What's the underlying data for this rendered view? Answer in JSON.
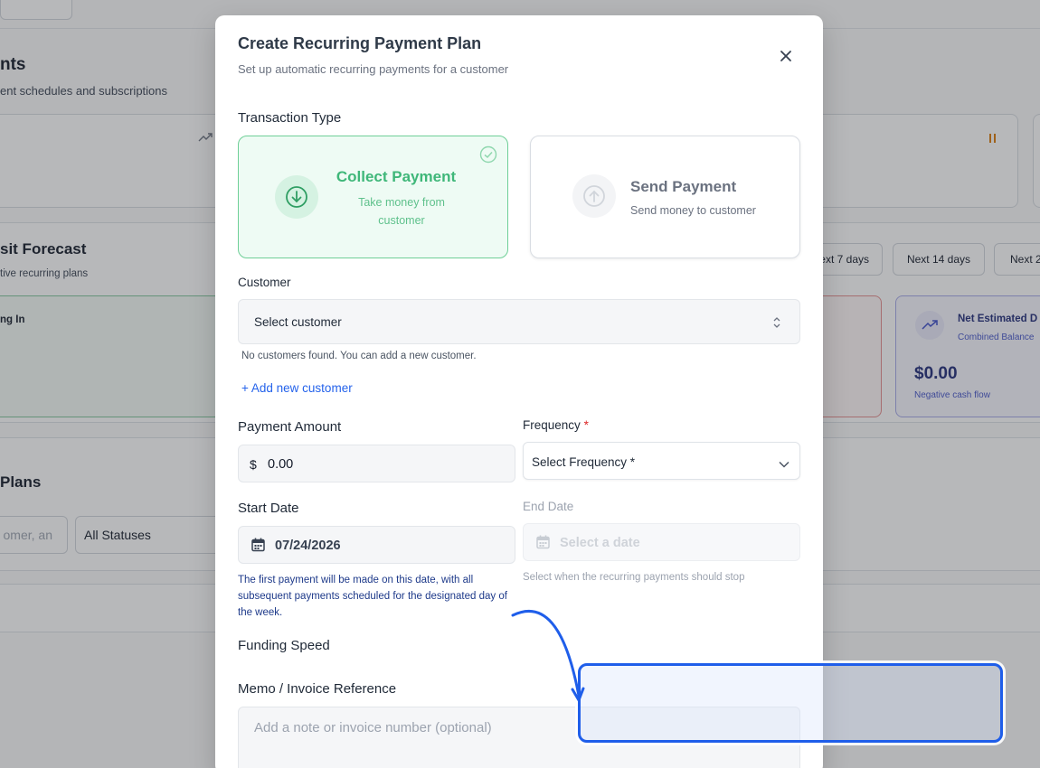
{
  "background": {
    "page_title_fragment": "nts",
    "page_subtitle_fragment": "ent schedules and subscriptions",
    "forecast_title_fragment": "sit Forecast",
    "forecast_subtitle_fragment": "tive recurring plans",
    "coming_in_fragment": "ng In",
    "range_buttons": [
      "ext 7 days",
      "Next 14 days",
      "Next 2"
    ],
    "net_card": {
      "title": "Net Estimated D",
      "subtitle": "Combined Balance",
      "value": "$0.00",
      "note": "Negative cash flow"
    },
    "plans_title_fragment": "Plans",
    "search_fragment": "omer, an",
    "status_filter": "All Statuses"
  },
  "modal": {
    "title": "Create Recurring Payment Plan",
    "subtitle": "Set up automatic recurring payments for a customer",
    "transaction_type": {
      "label": "Transaction Type",
      "collect": {
        "title": "Collect Payment",
        "desc": "Take money from customer",
        "selected": true
      },
      "send": {
        "title": "Send Payment",
        "desc": "Send money to customer",
        "selected": false
      }
    },
    "customer": {
      "label": "Customer",
      "placeholder": "Select customer",
      "empty_note": "No customers found. You can add a new customer.",
      "add_link": "+ Add new customer"
    },
    "payment_amount": {
      "label": "Payment Amount",
      "currency": "$",
      "value": "0.00"
    },
    "frequency": {
      "label": "Frequency",
      "required_mark": "*",
      "placeholder": "Select Frequency *"
    },
    "start_date": {
      "label": "Start Date",
      "value": "07/24/2026",
      "help": "The first payment will be made on this date, with all subsequent payments scheduled for the designated day of the week."
    },
    "end_date": {
      "label": "End Date",
      "placeholder": "Select a date",
      "help": "Select when the recurring payments should stop"
    },
    "funding_speed": {
      "label": "Funding Speed"
    },
    "memo": {
      "label": "Memo / Invoice Reference",
      "placeholder": "Add a note or invoice number (optional)"
    }
  },
  "colors": {
    "accent_green": "#3fb779",
    "link_blue": "#2563eb",
    "annotation_blue": "#1f5eea",
    "required_red": "#dc2626",
    "help_navy": "#1e3a8a"
  }
}
